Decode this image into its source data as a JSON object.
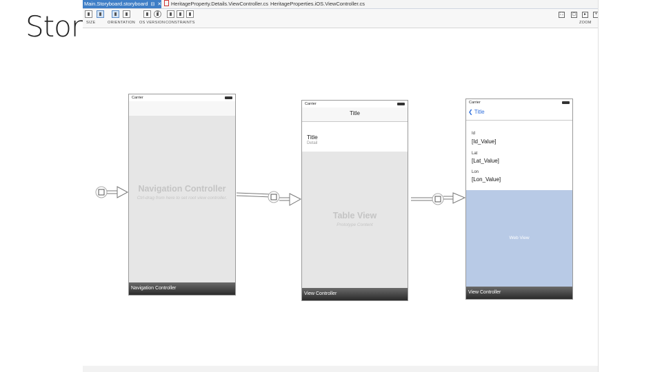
{
  "slide": {
    "title": "Story"
  },
  "tabs": [
    {
      "label": "Main.Storyboard.storyboard",
      "pin": "⊟",
      "close": "✕",
      "active": true
    },
    {
      "label": "HeritageProperty.Details.ViewController.cs",
      "active": false
    },
    {
      "label": "HeritageProperties.iOS.ViewController.cs",
      "active": false
    }
  ],
  "tab_overflow_icon": "chevron-down-icon",
  "toolbar": {
    "size_label": "SIZE",
    "orientation_label": "ORIENTATION",
    "os_version_label": "OS VERSION",
    "constraints_label": "CONSTRAINTS",
    "zoom_label": "ZOOM",
    "os_version_badge": "7"
  },
  "scenes": {
    "nav": {
      "carrier": "Carrier",
      "title": "Navigation Controller",
      "hint": "Ctrl-drag from here to set root view controller.",
      "footer": "Navigation Controller"
    },
    "table": {
      "carrier": "Carrier",
      "nav_title": "Title",
      "cell_title": "Title",
      "cell_subtitle": "Detail",
      "body_title": "Table View",
      "body_subtitle": "Prototype Content",
      "footer": "View Controller"
    },
    "detail": {
      "carrier": "Carrier",
      "back_label": "Title",
      "fields": [
        {
          "label": "Id",
          "value": "[Id_Value]"
        },
        {
          "label": "Lat",
          "value": "[Lat_Value]"
        },
        {
          "label": "Lon",
          "value": "[Lon_Value]"
        }
      ],
      "web_view_label": "Web View",
      "footer": "View Controller"
    }
  },
  "colors": {
    "active_tab": "#3e7ec6",
    "web_view": "#b8cae6",
    "ios_blue": "#2f6fdc",
    "scene_gray": "#e6e6e6"
  }
}
